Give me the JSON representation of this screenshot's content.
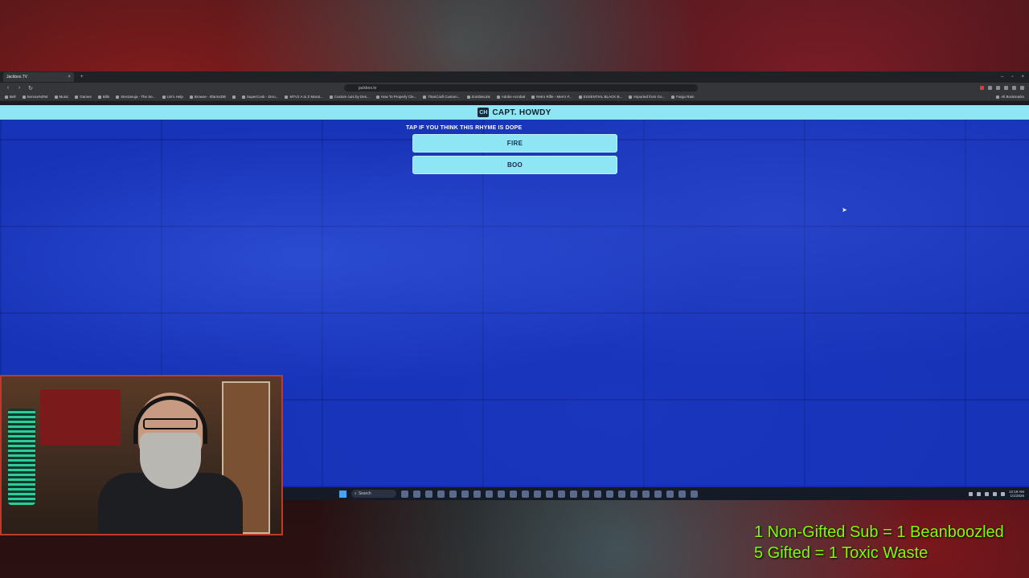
{
  "browser": {
    "tab_title": "Jackbox.TV",
    "tab_close": "×",
    "new_tab": "+",
    "url": "jackbox.tv",
    "window_controls": [
      "–",
      "▫",
      "×"
    ],
    "bookmarks": [
      "Bell",
      "ServiceNOW",
      "Music",
      "Games",
      "Bills",
      "Stectanuja - The Se...",
      "Uni's Help",
      "Browse - ItfarmsDB",
      "",
      "SuperCook - Zero...",
      "MTV2 A to Z Marat...",
      "Custom cuts by Des...",
      "How To Properly Cle...",
      "TitanCraft Custom...",
      "ZombieLink",
      "Adobe Acrobat",
      "Retro Rifle - Men's F...",
      "ESSENTIAL BLACK B...",
      "Imported from Go...",
      "Fargo Rain"
    ],
    "all_bookmarks": "All Bookmarks"
  },
  "game": {
    "header_logo": "CH",
    "header_title": "CAPT. HOWDY",
    "prompt": "TAP IF YOU THINK THIS RHYME IS DOPE",
    "choices": [
      "FIRE",
      "BOO"
    ]
  },
  "taskbar": {
    "search_placeholder": "Search",
    "clock_time": "12:19 AM",
    "clock_date": "1/1/2026"
  },
  "overlay": {
    "line1": "1 Non-Gifted Sub = 1 Beanboozled",
    "line2": "5 Gifted = 1 Toxic Waste"
  }
}
